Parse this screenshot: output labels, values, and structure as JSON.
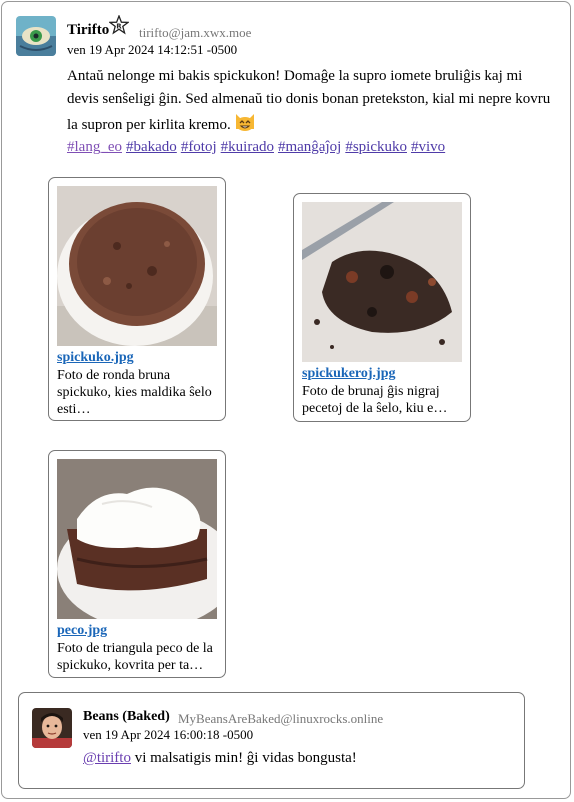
{
  "post": {
    "author": "Tirifto",
    "handle": "tirifto@jam.xwx.moe",
    "timestamp": "ven 19 Apr 2024 14:12:51 -0500",
    "text": "Antaŭ nelonge mi bakis spickukon! Domaĝe la supro iomete bruliĝis kaj mi devis senŝeligi ĝin. Sed almenaŭ tio donis bonan pretekston, kial mi nepre kovru la supron per kirlita kremo.",
    "tags": [
      "#lang_eo",
      "#bakado",
      "#fotoj",
      "#kuirado",
      "#manĝaĵoj",
      "#spickuko",
      "#vivo"
    ],
    "avatar_icon": "green-eye-avatar",
    "badge_icon": "bot-star-icon",
    "emoji_icon": "grinning-cat-emoji"
  },
  "attachments": [
    {
      "filename": "spickuko.jpg",
      "description": "Foto de ronda bruna spickuko, kies maldika ŝelo esti…",
      "icon": "round-cake-photo"
    },
    {
      "filename": "spickukeroj.jpg",
      "description": "Foto de brunaj ĝis nigraj pecetoj de la ŝelo, kiu e…",
      "icon": "cake-crumbs-photo"
    },
    {
      "filename": "peco.jpg",
      "description": "Foto de triangula peco de la spickuko, kovrita per ta…",
      "icon": "cake-slice-photo"
    }
  ],
  "reply": {
    "author": "Beans (Baked)",
    "handle": "MyBeansAreBaked@linuxrocks.online",
    "timestamp": "ven 19 Apr 2024 16:00:18 -0500",
    "mention": "@tirifto",
    "text": " vi malsatigis min! ĝi vidas bongusta!",
    "avatar_icon": "cartoon-person-avatar"
  },
  "colors": {
    "hashtag_link": "#4f3ba8",
    "filename_link": "#1a66b8",
    "handle_gray": "#777777"
  }
}
